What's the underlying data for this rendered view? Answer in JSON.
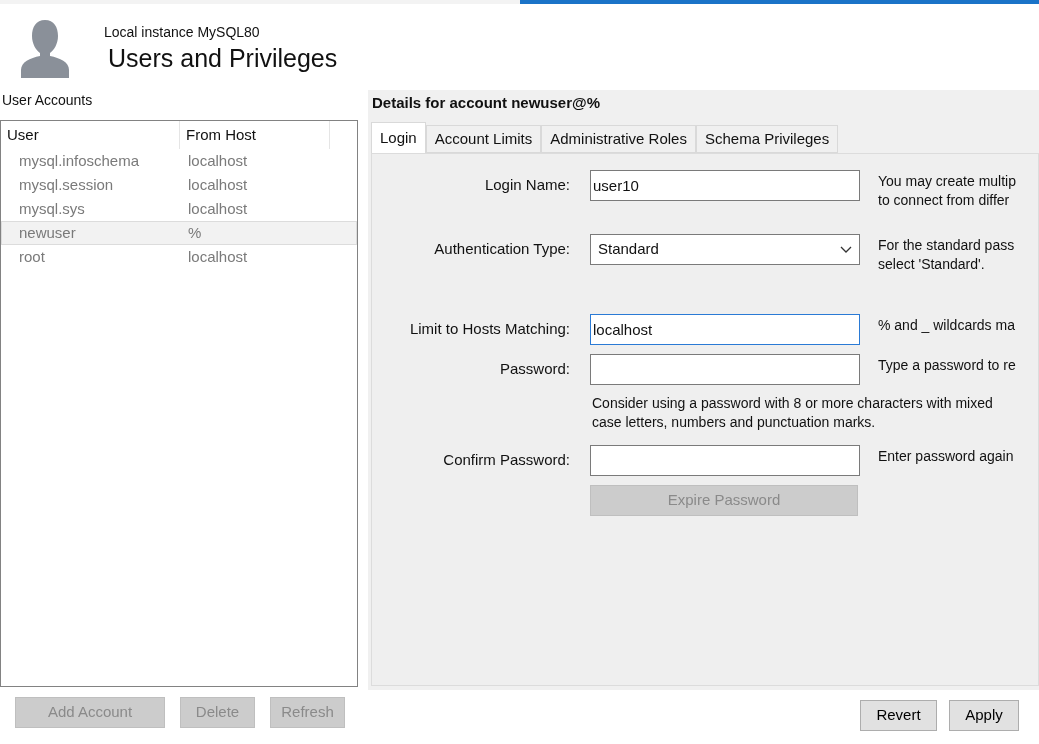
{
  "header": {
    "subtitle": "Local instance MySQL80",
    "title": "Users and Privileges"
  },
  "accounts": {
    "label": "User Accounts",
    "columns": [
      "User",
      "From Host"
    ],
    "rows": [
      {
        "user": "mysql.infoschema",
        "host": "localhost",
        "selected": false
      },
      {
        "user": "mysql.session",
        "host": "localhost",
        "selected": false
      },
      {
        "user": "mysql.sys",
        "host": "localhost",
        "selected": false
      },
      {
        "user": "newuser",
        "host": "%",
        "selected": true
      },
      {
        "user": "root",
        "host": "localhost",
        "selected": false
      }
    ],
    "buttons": [
      {
        "label": "Add Account",
        "disabled": true
      },
      {
        "label": "Delete",
        "disabled": true
      },
      {
        "label": "Refresh",
        "disabled": true
      }
    ]
  },
  "details": {
    "title": "Details for account newuser@%",
    "tabs": [
      {
        "label": "Login",
        "selected": true
      },
      {
        "label": "Account Limits",
        "selected": false
      },
      {
        "label": "Administrative Roles",
        "selected": false
      },
      {
        "label": "Schema Privileges",
        "selected": false
      }
    ],
    "rows": [
      {
        "kind": "text",
        "label": "Login Name:",
        "value": "user10",
        "focused": false,
        "hint": [
          "You may create multip",
          "to connect from differ"
        ]
      },
      {
        "kind": "select",
        "label": "Authentication Type:",
        "value": "Standard",
        "hint": [
          "For the standard pass",
          "select 'Standard'."
        ]
      },
      {
        "kind": "text",
        "label": "Limit to Hosts Matching:",
        "value": "localhost",
        "focused": true,
        "hint": [
          "% and _ wildcards ma"
        ]
      },
      {
        "kind": "password",
        "label": "Password:",
        "focused": false,
        "hint": [
          "Type a password to re"
        ]
      },
      {
        "kind": "note",
        "text": "Consider using a password with 8 or more characters with mixed case letters, numbers and punctuation marks."
      },
      {
        "kind": "password",
        "label": "Confirm Password:",
        "focused": false,
        "hint": [
          "Enter password again"
        ]
      },
      {
        "kind": "button",
        "label": "Expire Password",
        "disabled": true
      }
    ]
  },
  "footer_buttons": [
    {
      "label": "Revert",
      "disabled": false
    },
    {
      "label": "Apply",
      "disabled": false
    }
  ]
}
